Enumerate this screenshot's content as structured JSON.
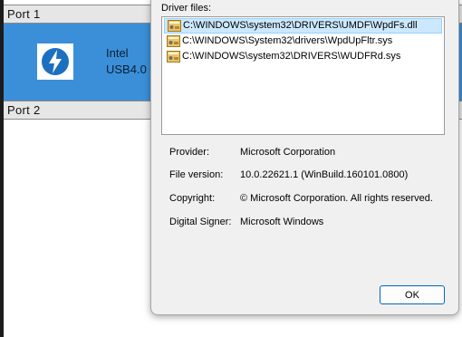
{
  "background_window": {
    "port1": {
      "title": "Port 1",
      "device_line1": "Intel",
      "device_line2": "USB4.0",
      "logo_icon": "thunderbolt-logo-icon",
      "accent_color": "#3b8fd8"
    },
    "port2": {
      "title": "Port 2"
    }
  },
  "dialog": {
    "driver_files_label": "Driver files:",
    "files": [
      {
        "path": "C:\\WINDOWS\\system32\\DRIVERS\\UMDF\\WpdFs.dll",
        "icon": "driver-file-icon",
        "selected": true
      },
      {
        "path": "C:\\WINDOWS\\System32\\drivers\\WpdUpFltr.sys",
        "icon": "driver-file-icon",
        "selected": false
      },
      {
        "path": "C:\\WINDOWS\\system32\\DRIVERS\\WUDFRd.sys",
        "icon": "driver-file-icon",
        "selected": false
      }
    ],
    "provider": {
      "label": "Provider:",
      "value": "Microsoft Corporation"
    },
    "file_version": {
      "label": "File version:",
      "value": "10.0.22621.1 (WinBuild.160101.0800)"
    },
    "copyright": {
      "label": "Copyright:",
      "value": "© Microsoft Corporation. All rights reserved."
    },
    "digital_signer": {
      "label": "Digital Signer:",
      "value": "Microsoft Windows"
    },
    "ok_label": "OK",
    "selection_color": "#cce8ff",
    "button_border_color": "#0067c0"
  }
}
